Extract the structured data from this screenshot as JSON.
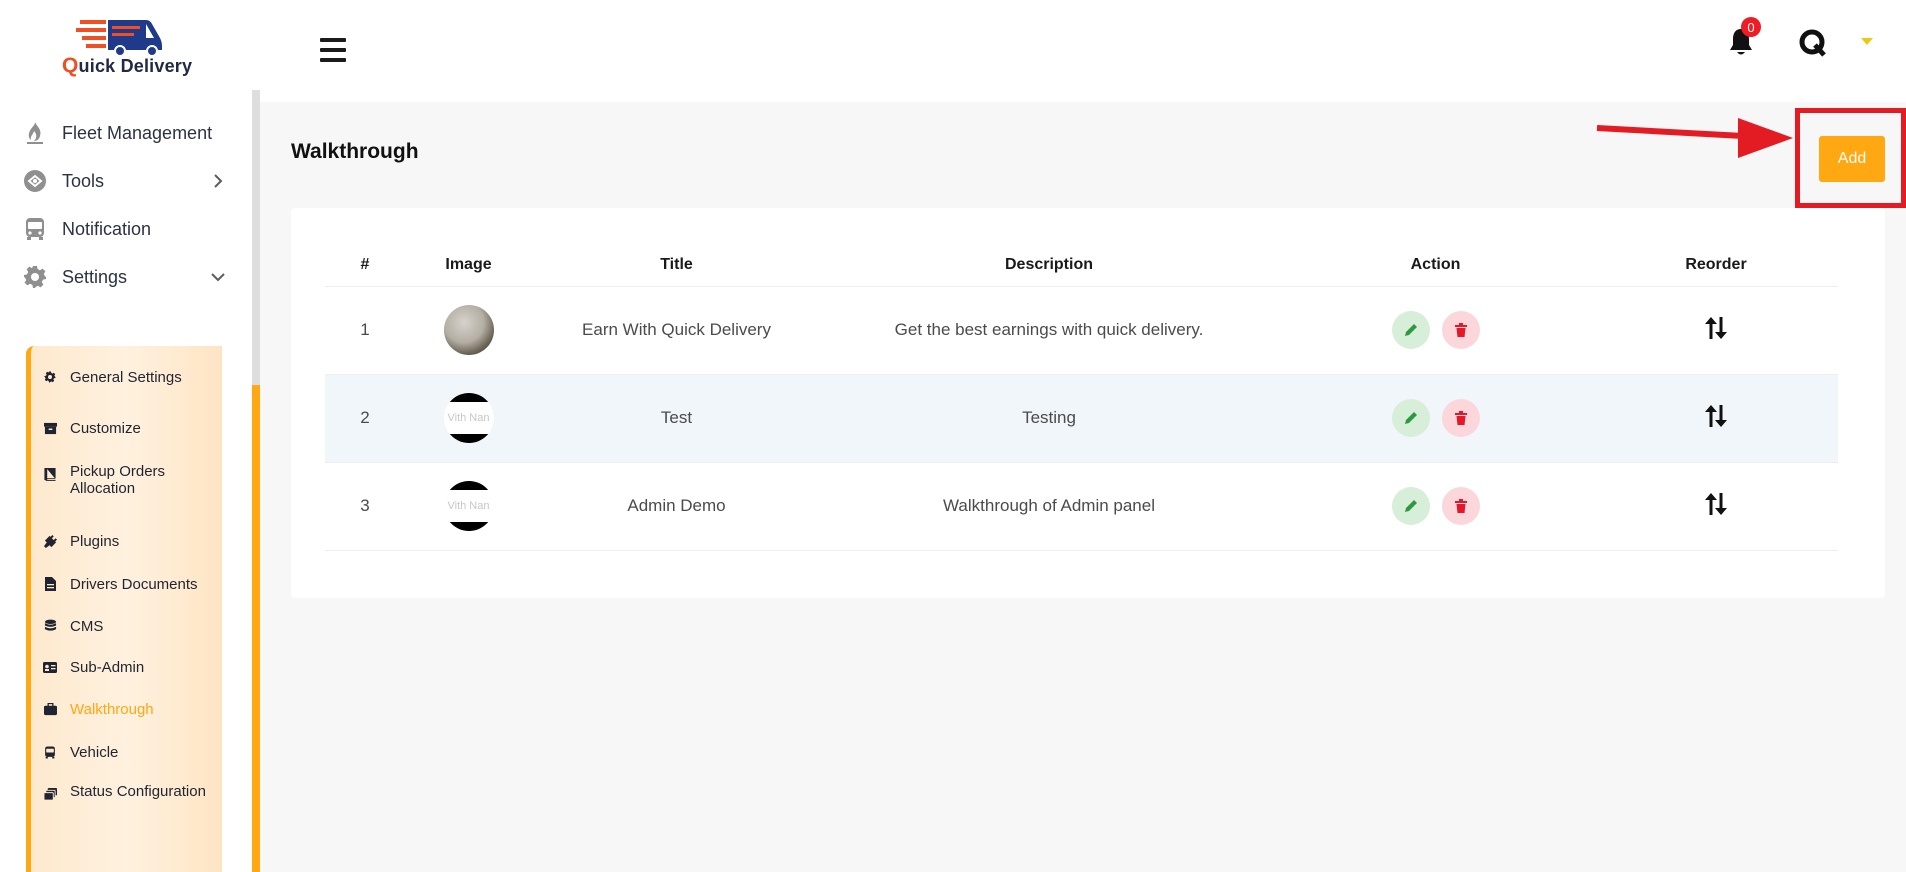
{
  "brand": {
    "name_initial": "Q",
    "name_rest": "uick Delivery",
    "colors": {
      "accent": "#ffa812",
      "logo_orange": "#f04e23",
      "logo_navy": "#1f3a8a",
      "highlight": "#e31b23"
    }
  },
  "sidebar": {
    "items": [
      {
        "label": "Fleet Management",
        "icon": "flame-icon"
      },
      {
        "label": "Tools",
        "icon": "tools-icon",
        "chevron": "chevron-right-icon"
      },
      {
        "label": "Notification",
        "icon": "bus-icon"
      },
      {
        "label": "Settings",
        "icon": "gear-icon",
        "chevron": "chevron-down-icon"
      }
    ],
    "submenu": [
      {
        "label": "General Settings",
        "icon": "gear-icon"
      },
      {
        "label": "Customize",
        "icon": "archive-icon"
      },
      {
        "label": "Pickup Orders Allocation",
        "icon": "book-icon"
      },
      {
        "label": "Plugins",
        "icon": "plug-icon"
      },
      {
        "label": "Drivers Documents",
        "icon": "file-icon"
      },
      {
        "label": "CMS",
        "icon": "database-icon"
      },
      {
        "label": "Sub-Admin",
        "icon": "id-card-icon"
      },
      {
        "label": "Walkthrough",
        "icon": "briefcase-icon",
        "active": true
      },
      {
        "label": "Vehicle",
        "icon": "bus-icon"
      },
      {
        "label": "Status Configuration",
        "icon": "layers-icon"
      }
    ]
  },
  "header": {
    "notification_count": "0"
  },
  "main": {
    "title": "Walkthrough",
    "add_label": "Add",
    "table": {
      "columns": [
        "#",
        "Image",
        "Title",
        "Description",
        "Action",
        "Reorder"
      ],
      "rows": [
        {
          "num": "1",
          "image": "photo",
          "image_text": "",
          "title": "Earn With Quick Delivery",
          "description": "Get the best earnings with quick delivery."
        },
        {
          "num": "2",
          "image": "placeholder",
          "image_text": "Vith Nan",
          "title": "Test",
          "description": "Testing"
        },
        {
          "num": "3",
          "image": "placeholder",
          "image_text": "Vith Nan",
          "title": "Admin Demo",
          "description": "Walkthrough of Admin panel"
        }
      ]
    }
  }
}
